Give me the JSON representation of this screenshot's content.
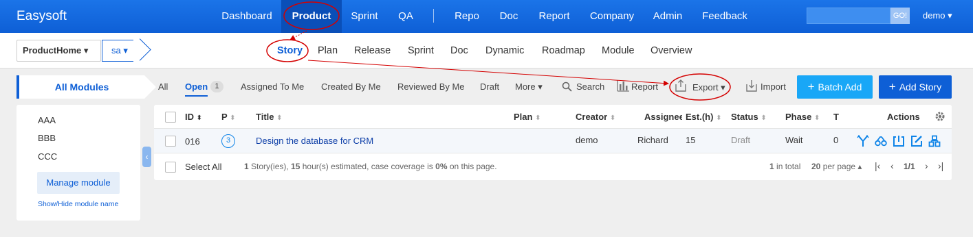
{
  "brand": "Easysoft",
  "topnav": [
    {
      "label": "Dashboard"
    },
    {
      "label": "Product"
    },
    {
      "label": "Sprint"
    },
    {
      "label": "QA"
    },
    {
      "label": "Repo"
    },
    {
      "label": "Doc"
    },
    {
      "label": "Report"
    },
    {
      "label": "Company"
    },
    {
      "label": "Admin"
    },
    {
      "label": "Feedback"
    }
  ],
  "search": {
    "go_label": "GO!",
    "value": ""
  },
  "user": "demo ▾",
  "breadcrumb": {
    "product_home": "ProductHome ▾",
    "product": "sa ▾"
  },
  "subnav": [
    {
      "label": "Story"
    },
    {
      "label": "Plan"
    },
    {
      "label": "Release"
    },
    {
      "label": "Sprint"
    },
    {
      "label": "Doc"
    },
    {
      "label": "Dynamic"
    },
    {
      "label": "Roadmap"
    },
    {
      "label": "Module"
    },
    {
      "label": "Overview"
    }
  ],
  "sidebar": {
    "title": "All Modules",
    "modules": [
      "AAA",
      "BBB",
      "CCC"
    ],
    "manage_label": "Manage module",
    "toggle_label": "Show/Hide module name",
    "collapse_icon": "‹"
  },
  "toolbar": {
    "all": "All",
    "open": "Open",
    "open_count": "1",
    "assigned": "Assigned To Me",
    "created": "Created By Me",
    "reviewed": "Reviewed By Me",
    "draft": "Draft",
    "more": "More ▾",
    "search": "Search",
    "report": "Report",
    "export": "Export ▾",
    "import": "Import",
    "batch_add": "Batch Add",
    "add_story": "Add Story"
  },
  "table": {
    "headers": {
      "id": "ID",
      "pri": "P",
      "title": "Title",
      "plan": "Plan",
      "creator": "Creator",
      "assignee": "Assignee",
      "estimate": "Est.(h)",
      "status": "Status",
      "phase": "Phase",
      "t": "T",
      "actions": "Actions"
    },
    "rows": [
      {
        "id": "016",
        "pri": "3",
        "title": "Design the database for CRM",
        "plan": "",
        "creator": "demo",
        "assignee": "Richard",
        "estimate": "15",
        "status": "Draft",
        "phase": "Wait",
        "t": "0"
      }
    ],
    "footer": {
      "select_all": "Select All",
      "summary_count": "1",
      "summary_a": " Story(ies), ",
      "summary_hours": "15",
      "summary_b": " hour(s) estimated, case coverage is ",
      "summary_cov": "0%",
      "summary_c": " on this page.",
      "total_num": "1",
      "total_label": " in total",
      "per_page": "20",
      "per_page_label": " per page ▴",
      "page": "1/1"
    }
  },
  "colors": {
    "brand_blue": "#0e5fd6",
    "header_active": "#0a4fb8",
    "batch_add": "#19a7f7",
    "annotation": "#d40000"
  }
}
